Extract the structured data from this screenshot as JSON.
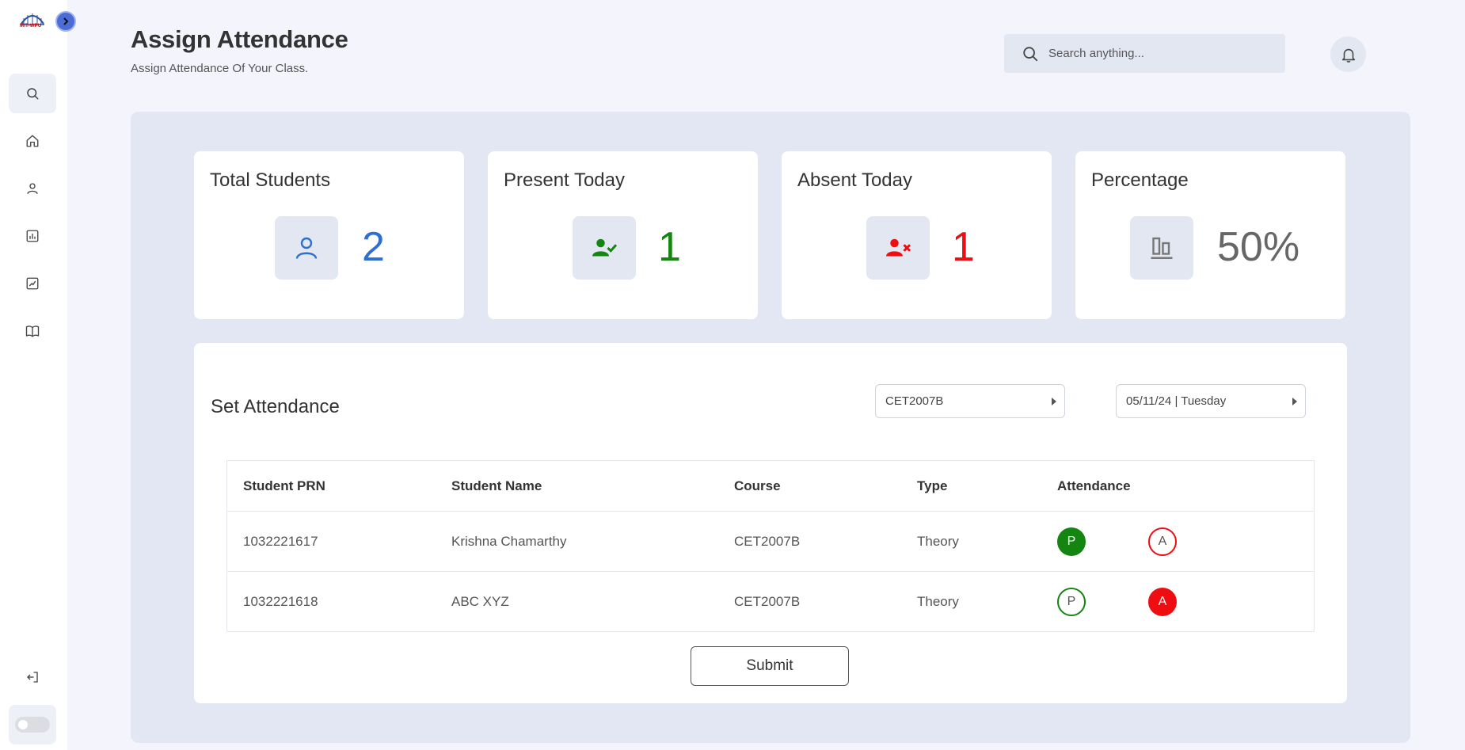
{
  "app": {
    "logo_text": "MIT-WPU"
  },
  "header": {
    "title": "Assign Attendance",
    "subtitle": "Assign Attendance Of Your Class.",
    "search_placeholder": "Search anything..."
  },
  "sidebar": {
    "items": [
      {
        "icon": "search-icon",
        "active": true
      },
      {
        "icon": "home-icon",
        "active": false
      },
      {
        "icon": "user-icon",
        "active": false
      },
      {
        "icon": "bar-chart-icon",
        "active": false
      },
      {
        "icon": "line-chart-icon",
        "active": false
      },
      {
        "icon": "book-icon",
        "active": false
      }
    ],
    "bottom": [
      {
        "icon": "logout-icon"
      },
      {
        "icon": "theme-toggle"
      }
    ]
  },
  "stats": [
    {
      "title": "Total Students",
      "value": "2",
      "color": "#2f6fd1",
      "icon": "user-icon"
    },
    {
      "title": "Present Today",
      "value": "1",
      "color": "#138510",
      "icon": "user-check-icon"
    },
    {
      "title": "Absent Today",
      "value": "1",
      "color": "#ee0d11",
      "icon": "user-x-icon"
    },
    {
      "title": "Percentage",
      "value": "50%",
      "color": "#666666",
      "icon": "chart-icon"
    }
  ],
  "attendance": {
    "title": "Set Attendance",
    "course_select": "CET2007B",
    "date_select": "05/11/24 | Tuesday",
    "columns": [
      "Student PRN",
      "Student Name",
      "Course",
      "Type",
      "Attendance"
    ],
    "rows": [
      {
        "prn": "1032221617",
        "name": "Krishna Chamarthy",
        "course": "CET2007B",
        "type": "Theory",
        "status": "P"
      },
      {
        "prn": "1032221618",
        "name": "ABC XYZ",
        "course": "CET2007B",
        "type": "Theory",
        "status": "A"
      }
    ],
    "present_label": "P",
    "absent_label": "A",
    "submit_label": "Submit"
  },
  "colors": {
    "present": "#138510",
    "absent": "#ee0d11",
    "accent": "#2f6fd1"
  }
}
